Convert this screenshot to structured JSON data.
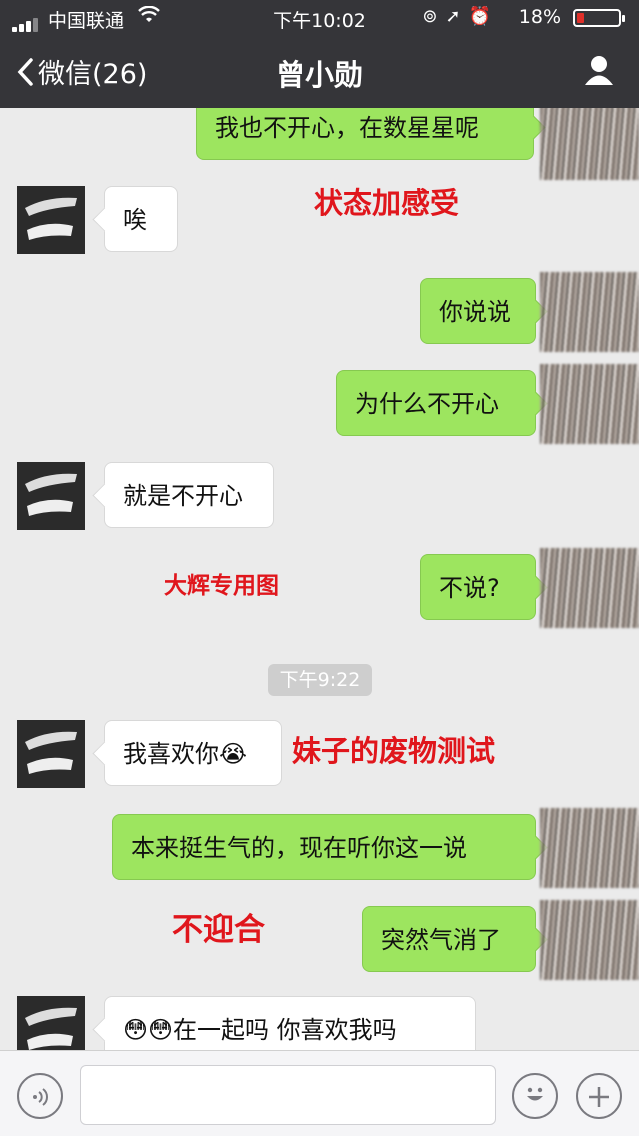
{
  "status_bar": {
    "carrier": "中国联通",
    "time": "下午10:02",
    "battery": "18%",
    "battery_level": 0.18,
    "battery_color": "#e0302a"
  },
  "nav": {
    "back_label": "微信(26)",
    "title": "曾小勋",
    "back_icon": "chevron-left-icon",
    "profile_icon": "person-icon"
  },
  "messages": [
    {
      "side": "right",
      "text": "我也不开心，在数星星呢"
    },
    {
      "side": "left",
      "text": "唉"
    },
    {
      "side": "right",
      "text": "你说说"
    },
    {
      "side": "right",
      "text": "为什么不开心"
    },
    {
      "side": "left",
      "text": "就是不开心"
    },
    {
      "side": "right",
      "text": "不说?"
    },
    {
      "side": "left",
      "text": "我喜欢你😭"
    },
    {
      "side": "right",
      "text": "本来挺生气的，现在听你这一说"
    },
    {
      "side": "right",
      "text": "突然气消了"
    },
    {
      "side": "left",
      "text": "😳😳在一起吗   你喜欢我吗"
    }
  ],
  "timestamp": "下午9:22",
  "annotations": {
    "a1": "状态加感受",
    "a2": "大辉专用图",
    "a3": "妹子的废物测试",
    "a4": "不迎合"
  },
  "colors": {
    "header": "#353539",
    "background": "#ebebeb",
    "bubble_right": "#9de55f",
    "bubble_left": "#ffffff",
    "annotation": "#e0161c"
  },
  "input_bar": {
    "voice_icon": "voice-icon",
    "emoji_icon": "emoji-icon",
    "plus_icon": "plus-icon",
    "placeholder": ""
  }
}
